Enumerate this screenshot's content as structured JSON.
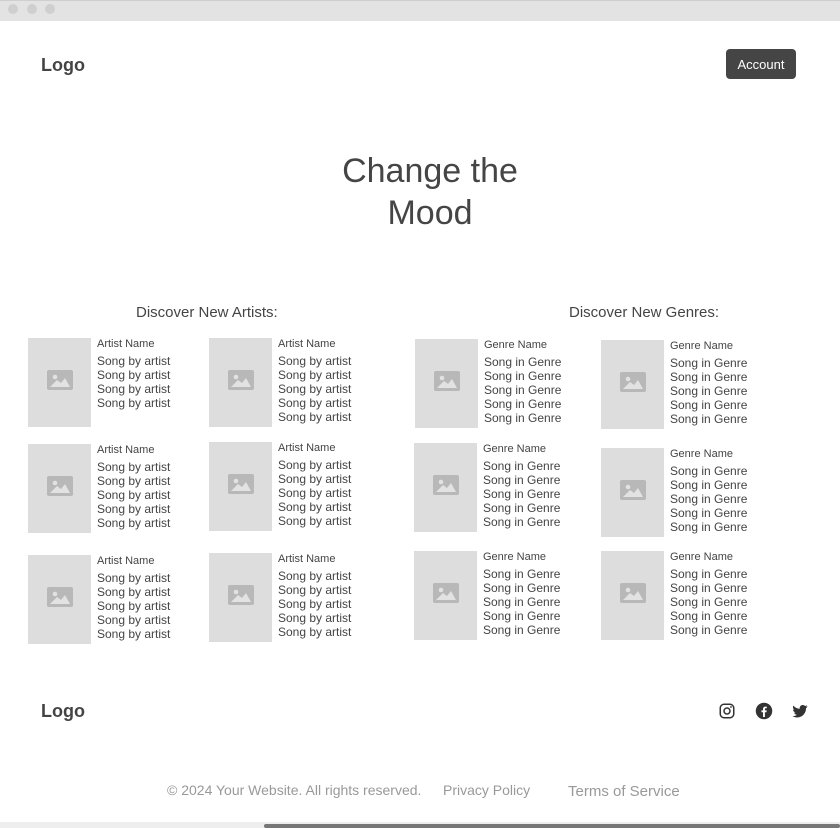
{
  "header": {
    "logo": "Logo",
    "account_label": "Account"
  },
  "hero": {
    "title": "Change the Mood"
  },
  "artists": {
    "title": "Discover New Artists:",
    "cards": [
      {
        "name": "Artist Name",
        "songs": [
          "Song by artist",
          "Song by artist",
          "Song by artist",
          "Song by artist"
        ]
      },
      {
        "name": "Artist Name",
        "songs": [
          "Song by artist",
          "Song by artist",
          "Song by artist",
          "Song by artist",
          "Song by artist"
        ]
      },
      {
        "name": "Artist Name",
        "songs": [
          "Song by artist",
          "Song by artist",
          "Song by artist",
          "Song by artist",
          "Song by artist"
        ]
      },
      {
        "name": "Artist Name",
        "songs": [
          "Song by artist",
          "Song by artist",
          "Song by artist",
          "Song by artist",
          "Song by artist"
        ]
      },
      {
        "name": "Artist Name",
        "songs": [
          "Song by artist",
          "Song by artist",
          "Song by artist",
          "Song by artist",
          "Song by artist"
        ]
      },
      {
        "name": "Artist Name",
        "songs": [
          "Song by artist",
          "Song by artist",
          "Song by artist",
          "Song by artist",
          "Song by artist"
        ]
      }
    ]
  },
  "genres": {
    "title": "Discover New Genres:",
    "cards": [
      {
        "name": "Genre Name",
        "songs": [
          "Song in Genre",
          "Song in Genre",
          "Song in Genre",
          "Song in Genre",
          "Song in Genre"
        ]
      },
      {
        "name": "Genre Name",
        "songs": [
          "Song in Genre",
          "Song in Genre",
          "Song in Genre",
          "Song in Genre",
          "Song in Genre"
        ]
      },
      {
        "name": "Genre Name",
        "songs": [
          "Song in Genre",
          "Song in Genre",
          "Song in Genre",
          "Song in Genre",
          "Song in Genre"
        ]
      },
      {
        "name": "Genre Name",
        "songs": [
          "Song in Genre",
          "Song in Genre",
          "Song in Genre",
          "Song in Genre",
          "Song in Genre"
        ]
      },
      {
        "name": "Genre Name",
        "songs": [
          "Song in Genre",
          "Song in Genre",
          "Song in Genre",
          "Song in Genre",
          "Song in Genre"
        ]
      },
      {
        "name": "Genre Name",
        "songs": [
          "Song in Genre",
          "Song in Genre",
          "Song in Genre",
          "Song in Genre",
          "Song in Genre"
        ]
      }
    ]
  },
  "footer": {
    "logo": "Logo",
    "copyright": "© 2024 Your Website. All rights reserved.",
    "privacy": "Privacy Policy",
    "terms": "Terms of Service",
    "social_icons": [
      "instagram-icon",
      "facebook-icon",
      "twitter-icon"
    ]
  },
  "colors": {
    "button_bg": "#454545",
    "placeholder_bg": "#dddddd",
    "text": "#444444"
  }
}
